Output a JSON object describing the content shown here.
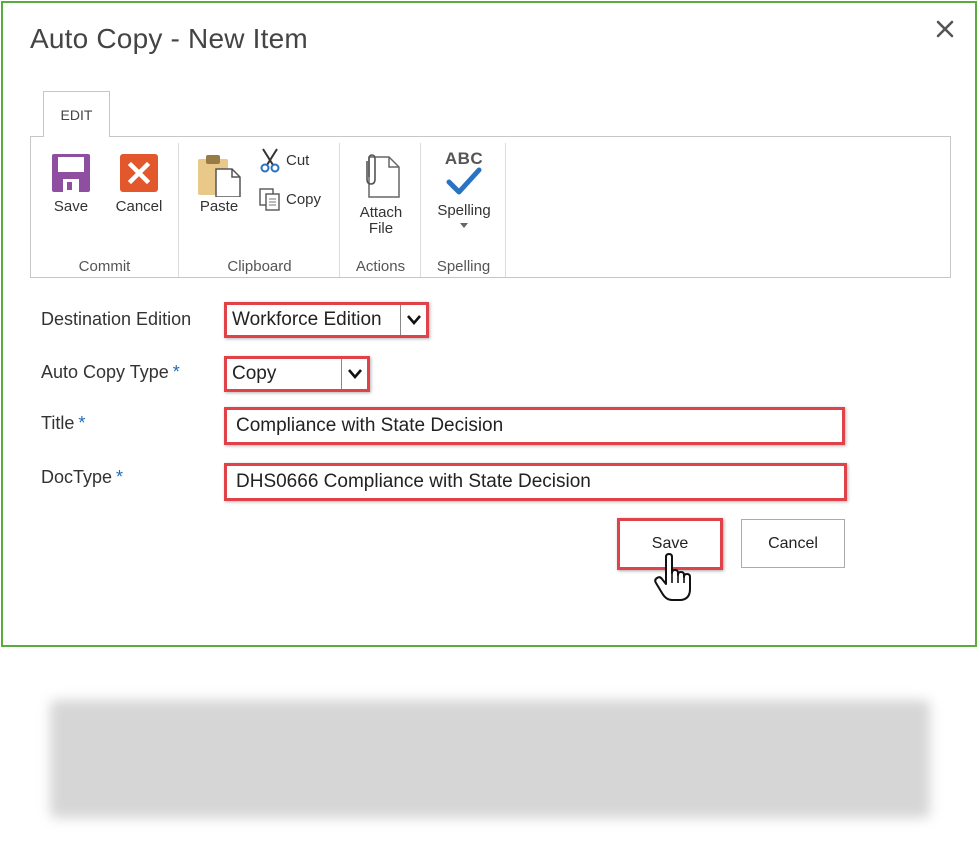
{
  "dialog": {
    "title": "Auto Copy - New Item",
    "close_symbol": "×"
  },
  "ribbon": {
    "tab_label": "EDIT",
    "groups": {
      "commit": {
        "label": "Commit",
        "save_label": "Save",
        "cancel_label": "Cancel"
      },
      "clipboard": {
        "label": "Clipboard",
        "paste_label": "Paste",
        "cut_label": "Cut",
        "copy_label": "Copy"
      },
      "actions": {
        "label": "Actions",
        "attach_label_line1": "Attach",
        "attach_label_line2": "File"
      },
      "spelling": {
        "label": "Spelling",
        "spelling_label": "Spelling",
        "abc_text": "ABC"
      }
    }
  },
  "form": {
    "destination_edition": {
      "label": "Destination Edition",
      "value": "Workforce Edition"
    },
    "auto_copy_type": {
      "label": "Auto Copy Type",
      "required": "*",
      "value": "Copy"
    },
    "title": {
      "label": "Title",
      "required": "*",
      "value": "Compliance with State Decision"
    },
    "doctype": {
      "label": "DocType",
      "required": "*",
      "value": "DHS0666 Compliance with State Decision"
    }
  },
  "buttons": {
    "save_label": "Save",
    "cancel_label": "Cancel"
  },
  "colors": {
    "dialog_border": "#5aac3d",
    "highlight": "#e0424a",
    "required_star": "#1f6db5",
    "save_icon": "#8e4fa0",
    "cancel_icon": "#e2572c",
    "spelling_check": "#2b72c4"
  },
  "icons": {
    "close": "close-icon",
    "save": "floppy-disk-icon",
    "cancel": "cancel-x-icon",
    "paste": "clipboard-paste-icon",
    "cut": "scissors-icon",
    "copy": "copy-icon",
    "attach": "paperclip-file-icon",
    "spelling": "abc-checkmark-icon",
    "dropdown": "chevron-down-icon",
    "cursor": "hand-pointer-icon"
  }
}
